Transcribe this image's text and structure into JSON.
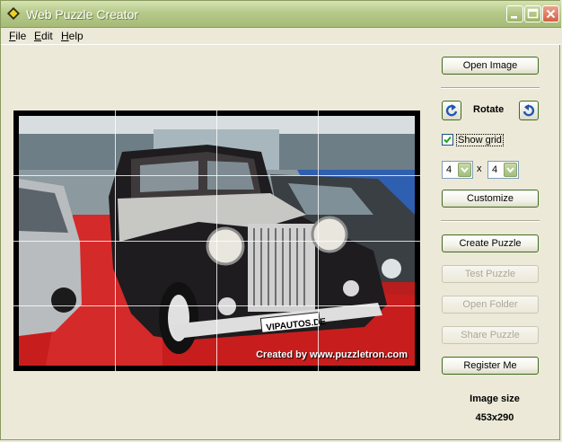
{
  "window": {
    "title": "Web Puzzle Creator",
    "accent": "#a5bb76"
  },
  "menu": {
    "items": [
      {
        "label": "File",
        "mnemonic": "F",
        "rest": "ile"
      },
      {
        "label": "Edit",
        "mnemonic": "E",
        "rest": "dit"
      },
      {
        "label": "Help",
        "mnemonic": "H",
        "rest": "elp"
      }
    ]
  },
  "image": {
    "watermark": "Created by www.puzzletron.com",
    "plate_text": "VIPAUTOS.DE",
    "grid_rows": 4,
    "grid_cols": 4
  },
  "panel": {
    "open_image": "Open Image",
    "rotate_label": "Rotate",
    "show_grid_label": "Show grid",
    "show_grid_checked": true,
    "rows_value": "4",
    "times": "x",
    "cols_value": "4",
    "customize": "Customize",
    "create_puzzle": "Create Puzzle",
    "test_puzzle": "Test Puzzle",
    "open_folder": "Open Folder",
    "share_puzzle": "Share Puzzle",
    "register_me": "Register Me",
    "image_size_label": "Image size",
    "image_size_value": "453x290"
  }
}
